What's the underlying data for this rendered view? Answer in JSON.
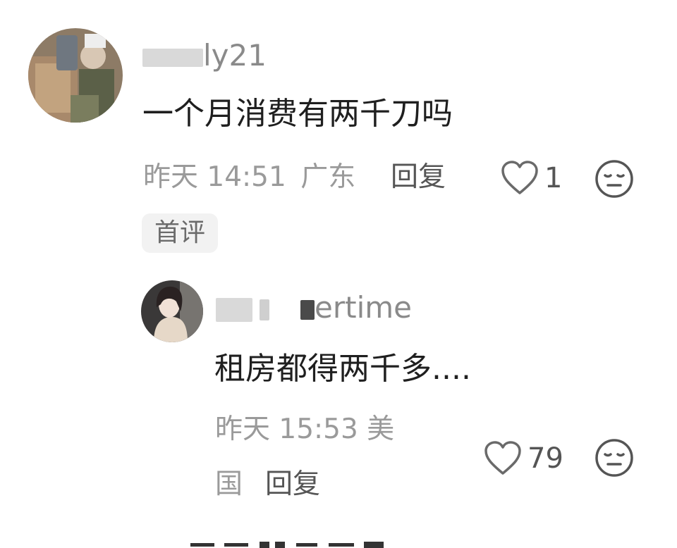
{
  "comments": [
    {
      "username_visible": "ly21",
      "text": "一个月消费有两千刀吗",
      "time": "昨天 14:51",
      "location": "广东",
      "reply_label": "回复",
      "likes": "1",
      "badge": "首评"
    }
  ],
  "reply": {
    "username_visible": "ertime",
    "text": "租房都得两千多....",
    "meta_line1": "昨天 15:53 美",
    "meta_line2": "国",
    "reply_label": "回复",
    "likes": "79"
  },
  "icons": {
    "like": "heart-outline-icon",
    "reaction": "neutral-face-icon"
  }
}
